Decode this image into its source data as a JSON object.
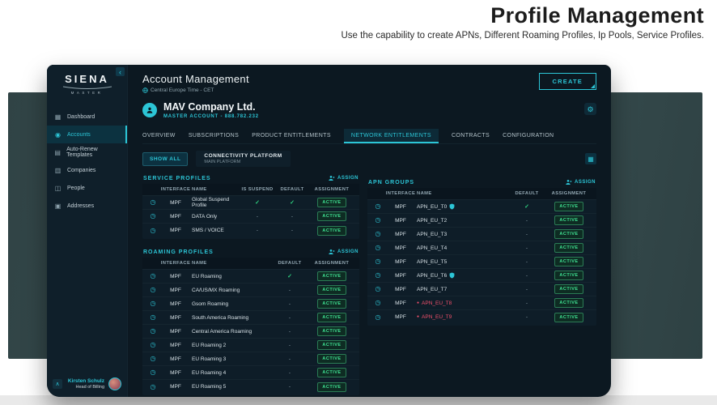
{
  "page": {
    "title": "Profile Management",
    "subtitle": "Use the capability to create APNs, Different Roaming Profiles, Ip Pools, Service Profiles."
  },
  "colors": {
    "accent": "#2cc5d6",
    "green": "#2fd380",
    "red": "#f2506b"
  },
  "sidebar": {
    "logo": "SIENA",
    "logo_sub": "MASTER",
    "items": [
      {
        "label": "Dashboard",
        "icon": "dashboard-icon",
        "active": false
      },
      {
        "label": "Accounts",
        "icon": "accounts-icon",
        "active": true
      },
      {
        "label": "Auto-Renew Templates",
        "icon": "templates-icon",
        "active": false
      },
      {
        "label": "Companies",
        "icon": "companies-icon",
        "active": false
      },
      {
        "label": "People",
        "icon": "people-icon",
        "active": false
      },
      {
        "label": "Addresses",
        "icon": "addresses-icon",
        "active": false
      }
    ],
    "user": {
      "name": "Kirsten Schulz",
      "role": "Head of Billing"
    }
  },
  "header": {
    "title": "Account Management",
    "timezone": "Central Europe Time - CET",
    "create_label": "CREATE"
  },
  "account": {
    "name": "MAV Company Ltd.",
    "subtitle": "MASTER ACCOUNT - 888.782.232"
  },
  "tabs": [
    {
      "label": "OVERVIEW",
      "active": false
    },
    {
      "label": "SUBSCRIPTIONS",
      "active": false
    },
    {
      "label": "PRODUCT ENTITLEMENTS",
      "active": false
    },
    {
      "label": "NETWORK ENTITLEMENTS",
      "active": true
    },
    {
      "label": "CONTRACTS",
      "active": false
    },
    {
      "label": "CONFIGURATION",
      "active": false
    }
  ],
  "filters": {
    "show_all": "SHOW ALL",
    "platform_title": "CONNECTIVITY PLATFORM",
    "platform_subtitle": "MAIN PLATFORM"
  },
  "panels": {
    "service_profiles": {
      "title": "SERVICE PROFILES",
      "assign_label": "ASSIGN",
      "columns": [
        {
          "label": "INTERFACE",
          "key": "interface"
        },
        {
          "label": "NAME",
          "key": "name"
        },
        {
          "label": "IS SUSPEND",
          "key": "is_suspend"
        },
        {
          "label": "DEFAULT",
          "key": "default"
        },
        {
          "label": "ASSIGNMENT",
          "key": "assignment"
        }
      ],
      "rows": [
        {
          "interface": "MPF",
          "name": "Global Suspend Profile",
          "is_suspend": "✓",
          "default": "✓",
          "assignment": "ACTIVE"
        },
        {
          "interface": "MPF",
          "name": "DATA Only",
          "is_suspend": "-",
          "default": "-",
          "assignment": "ACTIVE"
        },
        {
          "interface": "MPF",
          "name": "SMS / VOICE",
          "is_suspend": "-",
          "default": "-",
          "assignment": "ACTIVE"
        }
      ]
    },
    "roaming_profiles": {
      "title": "ROAMING PROFILES",
      "assign_label": "ASSIGN",
      "columns": [
        {
          "label": "INTERFACE",
          "key": "interface"
        },
        {
          "label": "NAME",
          "key": "name"
        },
        {
          "label": "DEFAULT",
          "key": "default"
        },
        {
          "label": "ASSIGNMENT",
          "key": "assignment"
        }
      ],
      "rows": [
        {
          "interface": "MPF",
          "name": "EU Roaming",
          "default": "✓",
          "assignment": "ACTIVE"
        },
        {
          "interface": "MPF",
          "name": "CA/US/MX Roaming",
          "default": "-",
          "assignment": "ACTIVE"
        },
        {
          "interface": "MPF",
          "name": "Gsom Roaming",
          "default": "-",
          "assignment": "ACTIVE"
        },
        {
          "interface": "MPF",
          "name": "South America Roaming",
          "default": "-",
          "assignment": "ACTIVE"
        },
        {
          "interface": "MPF",
          "name": "Central America Roaming",
          "default": "-",
          "assignment": "ACTIVE"
        },
        {
          "interface": "MPF",
          "name": "EU Roaming 2",
          "default": "-",
          "assignment": "ACTIVE"
        },
        {
          "interface": "MPF",
          "name": "EU Roaming 3",
          "default": "-",
          "assignment": "ACTIVE"
        },
        {
          "interface": "MPF",
          "name": "EU Roaming 4",
          "default": "-",
          "assignment": "ACTIVE"
        },
        {
          "interface": "MPF",
          "name": "EU Roaming 5",
          "default": "-",
          "assignment": "ACTIVE"
        }
      ]
    },
    "apn_groups": {
      "title": "APN GROUPS",
      "assign_label": "ASSIGN",
      "columns": [
        {
          "label": "INTERFACE",
          "key": "interface"
        },
        {
          "label": "NAME",
          "key": "name"
        },
        {
          "label": "DEFAULT",
          "key": "default"
        },
        {
          "label": "ASSIGNMENT",
          "key": "assignment"
        }
      ],
      "rows": [
        {
          "interface": "MPF",
          "name": "APN_EU_T0",
          "default": "✓",
          "assignment": "ACTIVE",
          "shield": true
        },
        {
          "interface": "MPF",
          "name": "APN_EU_T2",
          "default": "-",
          "assignment": "ACTIVE"
        },
        {
          "interface": "MPF",
          "name": "APN_EU_T3",
          "default": "-",
          "assignment": "ACTIVE"
        },
        {
          "interface": "MPF",
          "name": "APN_EU_T4",
          "default": "-",
          "assignment": "ACTIVE"
        },
        {
          "interface": "MPF",
          "name": "APN_EU_T5",
          "default": "-",
          "assignment": "ACTIVE"
        },
        {
          "interface": "MPF",
          "name": "APN_EU_T6",
          "default": "-",
          "assignment": "ACTIVE",
          "shield": true
        },
        {
          "interface": "MPF",
          "name": "APN_EU_T7",
          "default": "-",
          "assignment": "ACTIVE"
        },
        {
          "interface": "MPF",
          "name": "APN_EU_T8",
          "default": "-",
          "assignment": "ACTIVE",
          "alert": true
        },
        {
          "interface": "MPF",
          "name": "APN_EU_T9",
          "default": "-",
          "assignment": "ACTIVE",
          "alert": true
        }
      ]
    }
  }
}
